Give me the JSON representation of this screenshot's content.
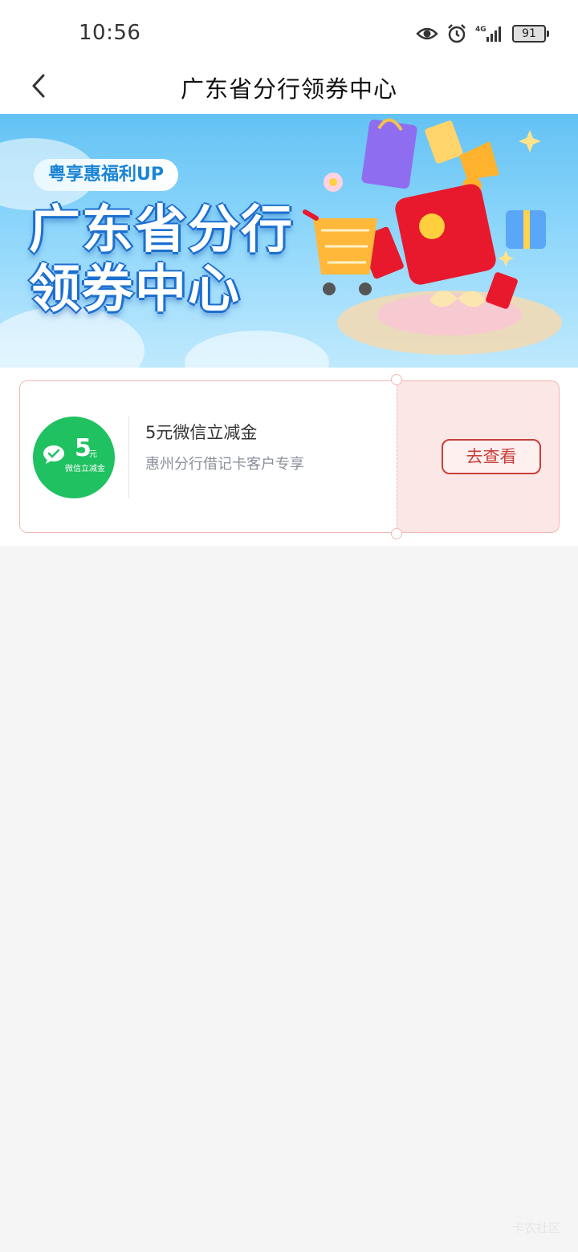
{
  "status_bar": {
    "time": "10:56",
    "signal_label": "4G",
    "battery": "91"
  },
  "header": {
    "title": "广东省分行领券中心"
  },
  "banner": {
    "tag": "粤享惠福利UP",
    "title_line1": "广东省分行",
    "title_line2": "领券中心"
  },
  "coupons": [
    {
      "badge_amount": "5",
      "badge_unit": "元",
      "badge_caption": "微信立减金",
      "title": "5元微信立减金",
      "description": "惠州分行借记卡客户专享",
      "button_label": "去查看"
    }
  ],
  "watermark": "卡农社区",
  "colors": {
    "accent_red": "#c8403a",
    "wechat_green": "#1fc160",
    "coupon_border": "#f2b8b3",
    "coupon_right_bg": "#fbe7e6"
  },
  "icons": [
    "eye-icon",
    "alarm-icon",
    "signal-icon",
    "battery-icon",
    "back-arrow-icon",
    "wechat-icon"
  ]
}
